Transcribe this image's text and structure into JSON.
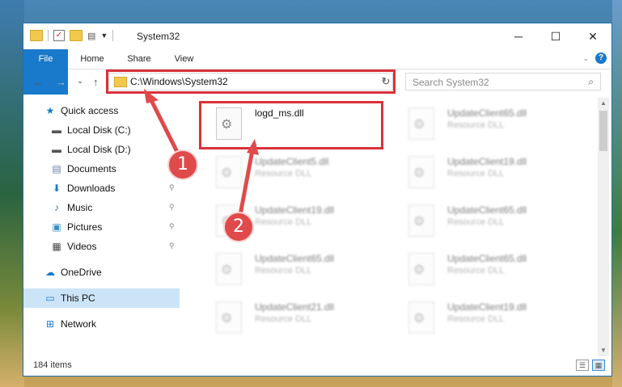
{
  "window": {
    "title": "System32",
    "controls": {
      "minimize": "─",
      "maximize": "☐",
      "close": "✕"
    }
  },
  "ribbon": {
    "tabs": [
      "File",
      "Home",
      "Share",
      "View"
    ],
    "help": "?"
  },
  "nav": {
    "back": "←",
    "forward": "→",
    "recent": "⌄",
    "up": "↑",
    "address": "C:\\Windows\\System32",
    "refresh": "↻",
    "search_placeholder": "Search System32"
  },
  "sidebar": {
    "items": [
      {
        "label": "Quick access",
        "icon": "star-icon",
        "glyph": "★",
        "color": "#1979ca",
        "pinned": false
      },
      {
        "label": "Local Disk (C:)",
        "icon": "drive-icon",
        "glyph": "▬",
        "color": "#555",
        "pinned": false
      },
      {
        "label": "Local Disk (D:)",
        "icon": "drive-icon",
        "glyph": "▬",
        "color": "#555",
        "pinned": false
      },
      {
        "label": "Documents",
        "icon": "documents-icon",
        "glyph": "▤",
        "color": "#6a7fa0",
        "pinned": true
      },
      {
        "label": "Downloads",
        "icon": "downloads-icon",
        "glyph": "⬇",
        "color": "#1979ca",
        "pinned": true
      },
      {
        "label": "Music",
        "icon": "music-icon",
        "glyph": "♪",
        "color": "#1979ca",
        "pinned": true
      },
      {
        "label": "Pictures",
        "icon": "pictures-icon",
        "glyph": "▣",
        "color": "#3a8fc0",
        "pinned": true
      },
      {
        "label": "Videos",
        "icon": "videos-icon",
        "glyph": "▦",
        "color": "#444",
        "pinned": true
      },
      {
        "label": "OneDrive",
        "icon": "cloud-icon",
        "glyph": "☁",
        "color": "#1979ca",
        "pinned": false
      },
      {
        "label": "This PC",
        "icon": "computer-icon",
        "glyph": "▭",
        "color": "#1979ca",
        "pinned": false,
        "selected": true
      },
      {
        "label": "Network",
        "icon": "network-icon",
        "glyph": "⊞",
        "color": "#1979ca",
        "pinned": false
      }
    ],
    "pin_glyph": "📌"
  },
  "files": {
    "highlighted": {
      "name": "logd_ms.dll"
    },
    "others": [
      {
        "name": "UpdateClient65.dll",
        "type": "Resource DLL"
      },
      {
        "name": "UpdateClient5.dll",
        "type": "Resource DLL"
      },
      {
        "name": "UpdateClient19.dll",
        "type": "Resource DLL"
      },
      {
        "name": "UpdateClient19.dll",
        "type": "Resource DLL"
      },
      {
        "name": "UpdateClient65.dll",
        "type": "Resource DLL"
      },
      {
        "name": "UpdateClient65.dll",
        "type": "Resource DLL"
      },
      {
        "name": "UpdateClient65.dll",
        "type": "Resource DLL"
      },
      {
        "name": "UpdateClient21.dll",
        "type": "Resource DLL"
      },
      {
        "name": "UpdateClient19.dll",
        "type": "Resource DLL"
      }
    ]
  },
  "status": {
    "count": "184 items"
  },
  "callouts": [
    "1",
    "2"
  ],
  "colors": {
    "accent": "#1979ca",
    "highlight": "#d9323a",
    "selected": "#cce4f7"
  }
}
